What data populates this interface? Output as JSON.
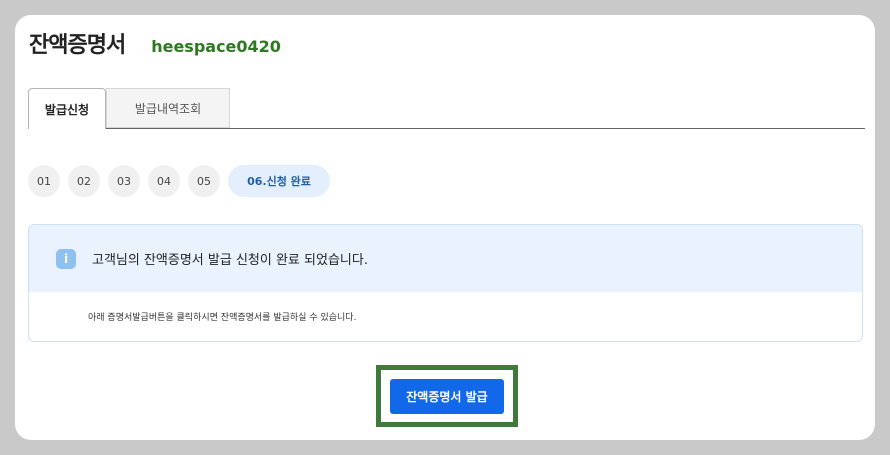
{
  "header": {
    "title": "잔액증명서",
    "user_id": "heespace0420"
  },
  "tabs": [
    {
      "label": "발급신청",
      "active": true
    },
    {
      "label": "발급내역조회",
      "active": false
    }
  ],
  "steps": [
    {
      "label": "01"
    },
    {
      "label": "02"
    },
    {
      "label": "03"
    },
    {
      "label": "04"
    },
    {
      "label": "05"
    },
    {
      "label": "06.신청 완료",
      "current": true
    }
  ],
  "notice": {
    "icon": "info-icon",
    "icon_glyph": "i",
    "message": "고객님의 잔액증명서 발급 신청이 완료 되었습니다.",
    "detail": "아래 증명서발급버튼을 클릭하시면 잔액증명서를 발급하실 수 있습니다."
  },
  "actions": {
    "issue_label": "잔액증명서 발급"
  },
  "colors": {
    "accent": "#1168e8",
    "user_id": "#2b7a1f",
    "highlight_frame": "#3f7a3a"
  }
}
